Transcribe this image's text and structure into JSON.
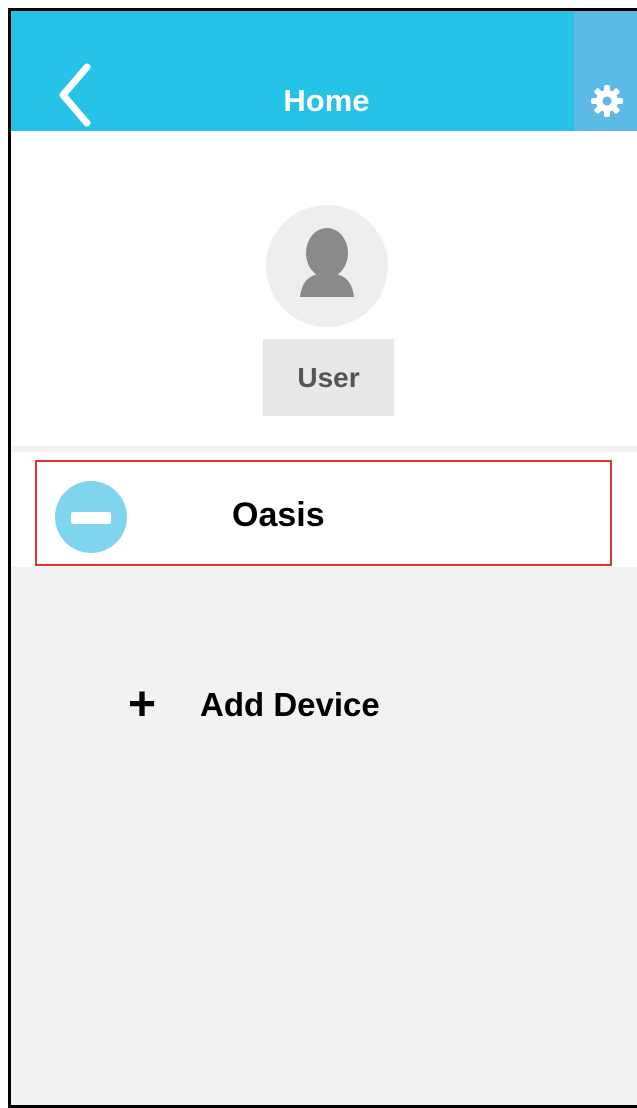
{
  "header": {
    "title": "Home",
    "back_icon": "chevron-left-icon",
    "settings_icon": "gear-icon"
  },
  "user": {
    "avatar_icon": "user-silhouette-icon",
    "label": "User"
  },
  "devices": [
    {
      "name": "Oasis",
      "icon": "air-conditioner-icon",
      "highlighted": true
    }
  ],
  "add_device": {
    "icon": "plus-icon",
    "label": "Add Device"
  },
  "colors": {
    "header": "#26c2e8",
    "settings_bg": "#5bbbe6",
    "highlight_border": "#e23232",
    "device_icon": "#7fd4ee",
    "page_bg": "#f2f2f2"
  }
}
